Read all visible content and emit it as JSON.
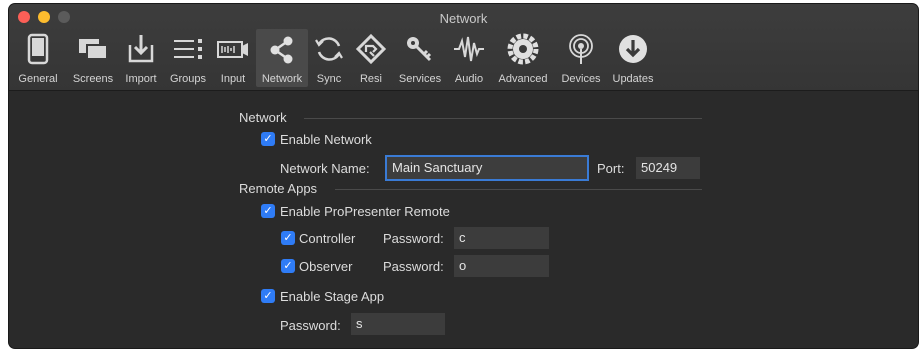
{
  "window": {
    "title": "Network"
  },
  "toolbar": [
    {
      "label": "General",
      "icon": "general-icon"
    },
    {
      "label": "Screens",
      "icon": "screens-icon"
    },
    {
      "label": "Import",
      "icon": "import-icon"
    },
    {
      "label": "Groups",
      "icon": "groups-icon"
    },
    {
      "label": "Input",
      "icon": "input-icon"
    },
    {
      "label": "Network",
      "icon": "network-share-icon",
      "selected": true
    },
    {
      "label": "Sync",
      "icon": "sync-icon"
    },
    {
      "label": "Resi",
      "icon": "resi-icon"
    },
    {
      "label": "Services",
      "icon": "key-icon"
    },
    {
      "label": "Audio",
      "icon": "waveform-icon"
    },
    {
      "label": "Advanced",
      "icon": "gear-icon"
    },
    {
      "label": "Devices",
      "icon": "broadcast-icon"
    },
    {
      "label": "Updates",
      "icon": "download-icon"
    }
  ],
  "network": {
    "section_title": "Network",
    "enable_label": "Enable Network",
    "enabled": true,
    "name_label": "Network Name:",
    "name_value": "Main Sanctuary",
    "port_label": "Port:",
    "port_value": "50249"
  },
  "remote": {
    "section_title": "Remote Apps",
    "enable_remote_label": "Enable ProPresenter Remote",
    "enable_remote": true,
    "controller": {
      "label": "Controller",
      "checked": true,
      "password_label": "Password:",
      "password": "c"
    },
    "observer": {
      "label": "Observer",
      "checked": true,
      "password_label": "Password:",
      "password": "o"
    },
    "stage": {
      "label": "Enable Stage App",
      "checked": true,
      "password_label": "Password:",
      "password": "s"
    }
  },
  "colors": {
    "accent": "#2f7cf6",
    "background": "#2a2a2a",
    "toolbar": "#383838"
  }
}
